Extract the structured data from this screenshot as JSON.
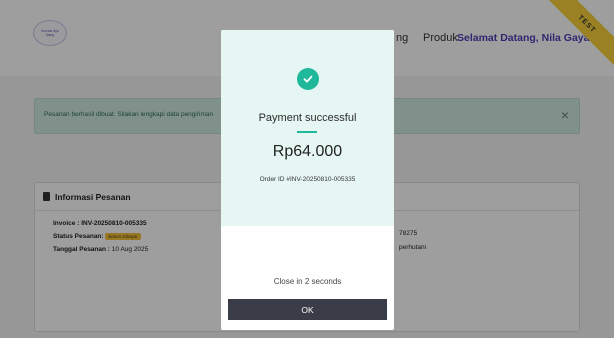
{
  "nav": {
    "logo_text": "Inovasi Ayu Nang",
    "partial_item": "ng",
    "produk": "Produk",
    "welcome": "Selamat Datang, Nila Gayatri!"
  },
  "ribbon": {
    "label": "TEST"
  },
  "alert": {
    "message": "Pesanan berhasil dibuat. Silakan lengkapi data pengiriman",
    "close_icon": "close-icon"
  },
  "card": {
    "title": "Informasi Pesanan",
    "invoice_label": "Invoice :",
    "invoice_value": "INV-20250810-005335",
    "status_label": "Status Pesanan:",
    "status_badge": "Belum Dibayar",
    "date_label": "Tanggal Pesanan :",
    "date_value": "10 Aug 2025",
    "right_1": "78275",
    "right_2": "perhutani"
  },
  "modal": {
    "icon": "check-circle-icon",
    "title": "Payment successful",
    "amount": "Rp64.000",
    "order_id": "Order ID #INV-20250810-005335",
    "close_text": "Close in 2 seconds",
    "ok_label": "OK"
  },
  "colors": {
    "accent": "#1fb89a",
    "modal_top": "#e6f7f3",
    "button": "#3a3d47",
    "welcome": "#4b3fb5",
    "ribbon": "#f7d13a"
  }
}
